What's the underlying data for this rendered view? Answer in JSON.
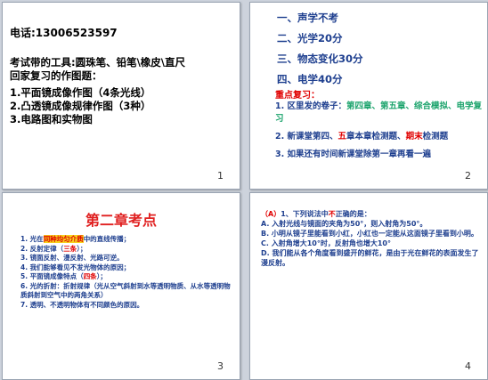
{
  "slide1": {
    "phone": "电话:13006523597",
    "tools": "考试带的工具:圆珠笔、铅笔\\橡皮\\直尺",
    "review": "回家复习的作图题：",
    "list": [
      "1.平面镜成像作图（4条光线）",
      "2.凸透镜成像规律作图（3种）",
      "3.电路图和实物图"
    ],
    "page": "1"
  },
  "slide2": {
    "topics": [
      "一、声学不考",
      "二、光学20分",
      "三、物态变化30分",
      "四、电学40分"
    ],
    "key_label": "重点复习：",
    "item1_prefix": "1. 区里发的卷子：",
    "item1_green": "第四章、第五章、综合模拟、电学复习",
    "item2_prefix": "2. 新课堂第四、",
    "item2_red1": "五",
    "item2_mid": "章本章检测题、",
    "item2_red2": "期末",
    "item2_suffix": "检测题",
    "item3": "3. 如果还有时间新课堂除第一章再看一遍",
    "page": "2"
  },
  "slide3": {
    "title": "第二章考点",
    "p1_pre": "1. 光在",
    "p1_hl": "同种均匀介质",
    "p1_post": "中的直线传播；",
    "p2_pre": "2. 反射定律（",
    "p2_red": "三条",
    "p2_post": "）；",
    "p3": "3. 镜面反射、漫反射、光路可逆。",
    "p4": "4. 我们能够看见不发光物体的原因；",
    "p5_pre": "5. 平面镜成像特点（",
    "p5_red": "四条",
    "p5_post": "）；",
    "p6": "6. 光的折射：折射规律（光从空气斜射到水等透明物质、从水等透明物质斜射到空气中的两角关系）",
    "p7": "7. 透明、不透明物体有不同颜色的原因。",
    "page": "3"
  },
  "slide4": {
    "answer": "（A）",
    "q_pre": "1、下列说法中",
    "q_red": "不",
    "q_post": "正确的是：",
    "a": "A. 入射光线与镜面的夹角为50°，则入射角为50°。",
    "b": "B. 小明从镜子里能看到小红，小红也一定能从这面镜子里看到小明。",
    "c": "C. 入射角增大10°时，反射角也增大10°",
    "d": "D. 我们能从各个角度看到盛开的鲜花，是由于光在鲜花的表面发生了漫反射。",
    "page": "4"
  }
}
